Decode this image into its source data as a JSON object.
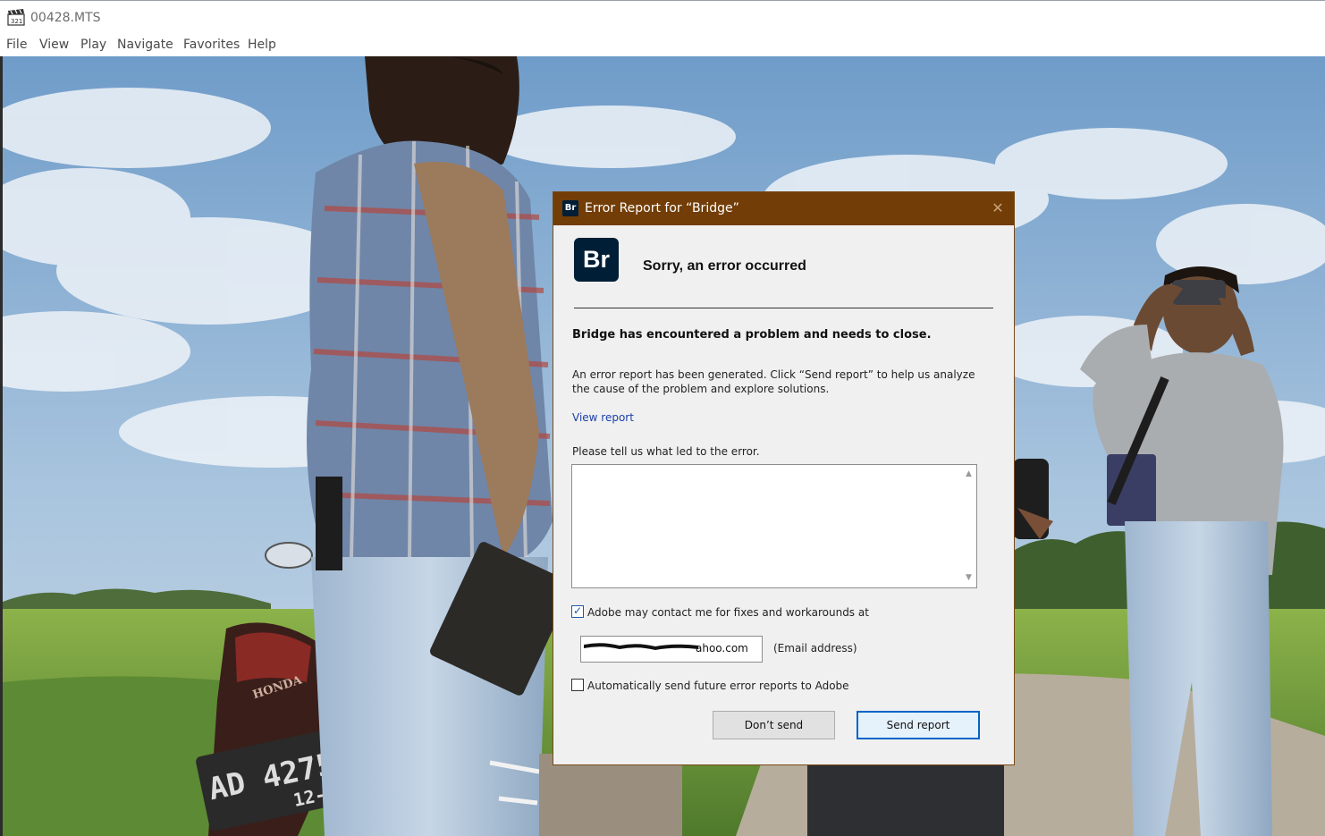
{
  "window": {
    "title": "00428.MTS",
    "menu": [
      "File",
      "View",
      "Play",
      "Navigate",
      "Favorites",
      "Help"
    ]
  },
  "video": {
    "plate_line1": "AD 4275 CP",
    "plate_line2": "12-21",
    "bike_brand": "HONDA"
  },
  "dialog": {
    "title": "Error Report for “Bridge”",
    "logo": "Br",
    "heading": "Sorry, an error occurred",
    "message_bold": "Bridge has encountered a problem and needs to close.",
    "message": "An error report has been generated. Click “Send report” to help us analyze the cause of the problem and explore solutions.",
    "view_report": "View report",
    "prompt": "Please tell us what led to the error.",
    "textarea_value": "",
    "contact_label": "Adobe may contact me for fixes and workarounds at",
    "contact_checked": true,
    "email_value": "ahoo.com",
    "email_hint": "(Email address)",
    "auto_send_label": "Automatically send future error reports to Adobe",
    "auto_send_checked": false,
    "dont_send": "Don’t send",
    "send_report": "Send report"
  },
  "colors": {
    "dialog_titlebar": "#723d06",
    "logo_bg": "#001e36",
    "link": "#1a3fa8",
    "primary_border": "#0064c8"
  }
}
